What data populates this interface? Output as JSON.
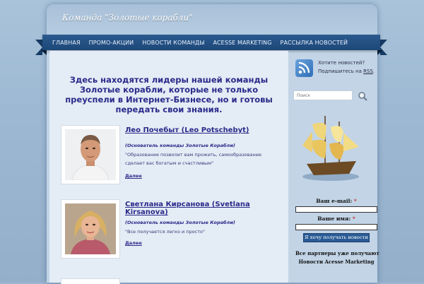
{
  "site": {
    "title": "Команда \"Золотые корабли\""
  },
  "nav": {
    "items": [
      {
        "label": "ГЛАВНАЯ"
      },
      {
        "label": "ПРОМО-АКЦИИ"
      },
      {
        "label": "НОВОСТИ КОМАНДЫ"
      },
      {
        "label": "ACESSE MARKETING"
      },
      {
        "label": "РАССЫЛКА НОВОСТЕЙ"
      }
    ]
  },
  "intro": {
    "text": "Здесь находятся лидеры нашей команды Золотые корабли, которые не только преуспели в Интернет-Бизнесе, но и готовы передать свои знания."
  },
  "members": [
    {
      "name": "Лео Почебыт (Leo Potschebyt)",
      "role": "(Основатель команды Золотые Корабли)",
      "quote": "\"Образование позволит вам прожить, самообразование сделает вас богатым и счастливым\"",
      "more": "Далее"
    },
    {
      "name": "Светлана Кирсанова (Svetlana Kirsanova)",
      "role": "(Основатель команды Золотые Корабли)",
      "quote": "\"Все получается легко и просто\"",
      "more": "Далее"
    }
  ],
  "sidebar": {
    "rss_line1": "Хотите новостей?",
    "rss_line2_prefix": "Подпишитесь на ",
    "rss_link": "RSS",
    "rss_line2_suffix": ".",
    "search_placeholder": "Поиск",
    "email_label": "Ваш e-mail:",
    "name_label": "Ваше имя:",
    "required_mark": "*",
    "submit_label": "Я хочу получать новости",
    "partners_line1": "Все партнеры уже получают",
    "partners_line2": "Новости Acesse Marketing"
  },
  "icons": {
    "rss": "rss-icon",
    "search": "search-icon",
    "ship": "ship-image"
  }
}
